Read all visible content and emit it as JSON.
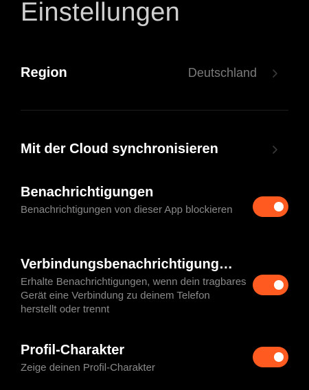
{
  "page": {
    "title": "Einstellungen"
  },
  "colors": {
    "background": "#000000",
    "accent": "#ff5a1f",
    "primary_text": "#ffffff",
    "secondary_text": "#8a8a8a"
  },
  "settings": {
    "region": {
      "label": "Region",
      "value": "Deutschland",
      "icon": "chevron-right-icon"
    },
    "cloud_sync": {
      "label": "Mit der Cloud synchronisieren",
      "icon": "chevron-right-icon"
    },
    "notifications": {
      "label": "Benachrichtigungen",
      "description": "Benachrichtigungen von dieser App blockieren",
      "enabled": true
    },
    "connection_notifications": {
      "label": "Verbindungsbenachrichtigung…",
      "description": "Erhalte Benachrichtigungen, wenn dein tragbares Gerät eine Verbindung zu deinem Telefon herstellt oder trennt",
      "enabled": true
    },
    "profile_character": {
      "label": "Profil-Charakter",
      "description": "Zeige deinen Profil-Charakter",
      "enabled": true
    }
  }
}
